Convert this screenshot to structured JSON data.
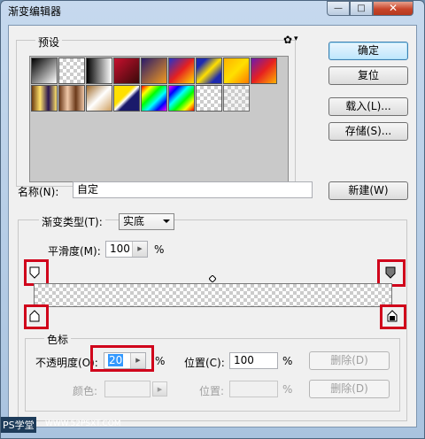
{
  "window": {
    "title": "渐变编辑器",
    "min": "—",
    "max": "□",
    "close": "✕"
  },
  "presets": {
    "label": "预设",
    "gear": "✿",
    "gear_arrow": "▾"
  },
  "buttons": {
    "ok": "确定",
    "reset": "复位",
    "load": "载入(L)...",
    "save": "存储(S)...",
    "new": "新建(W)"
  },
  "name": {
    "label": "名称(N):",
    "value": "自定"
  },
  "gradient": {
    "type_label": "渐变类型(T):",
    "type_value": "实底",
    "smooth_label": "平滑度(M):",
    "smooth_value": "100",
    "smooth_unit": "%"
  },
  "stops": {
    "label": "色标",
    "opacity_label": "不透明度(O):",
    "opacity_value": "20",
    "opacity_unit": "%",
    "opacity_pos_label": "位置(C):",
    "opacity_pos_value": "100",
    "opacity_pos_unit": "%",
    "delete1": "删除(D)",
    "color_label": "颜色:",
    "color_pos_label": "位置:",
    "color_pos_unit": "%",
    "delete2": "删除(D)"
  },
  "watermark": {
    "logo": "PS学堂",
    "url": "WWW.52PSXT.COM"
  },
  "colors": {
    "highlight": "#d0021b",
    "default_button": "#3c7fb1"
  }
}
